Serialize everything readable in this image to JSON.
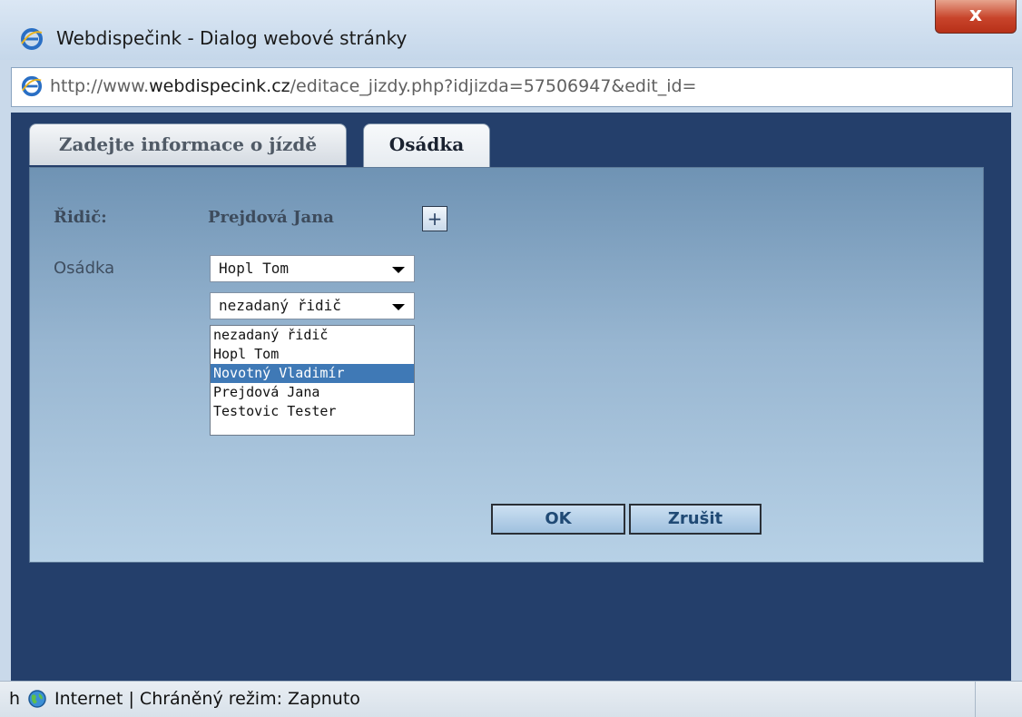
{
  "window": {
    "title": "Webdispečink - Dialog webové stránky",
    "close_glyph": "x",
    "icon": "ie-icon"
  },
  "address": {
    "url_prefix": "http://www.",
    "url_domain": "webdispecink.cz",
    "url_path": "/editace_jizdy.php?idjizda=57506947&edit_id="
  },
  "tabs": [
    {
      "label": "Zadejte informace o jízdě",
      "active": false
    },
    {
      "label": "Osádka",
      "active": true
    }
  ],
  "form": {
    "driver_label": "Řidič:",
    "driver_value": "Prejdová Jana",
    "add_label": "+",
    "crew_label": "Osádka",
    "crew_select_1": "Hopl Tom",
    "crew_select_2": "nezadaný řidič",
    "dropdown_options": [
      {
        "label": "nezadaný řidič",
        "highlighted": false
      },
      {
        "label": "Hopl Tom",
        "highlighted": false
      },
      {
        "label": "Novotný Vladimír",
        "highlighted": true
      },
      {
        "label": "Prejdová Jana",
        "highlighted": false
      },
      {
        "label": "Testovic Tester",
        "highlighted": false
      }
    ],
    "ok_label": "OK",
    "cancel_label": "Zrušit"
  },
  "statusbar": {
    "prefix": "h",
    "text": "Internet | Chráněný režim: Zapnuto"
  },
  "colors": {
    "content_bg": "#243f6b",
    "highlight": "#3f79b6",
    "close_button": "#c8442b"
  }
}
